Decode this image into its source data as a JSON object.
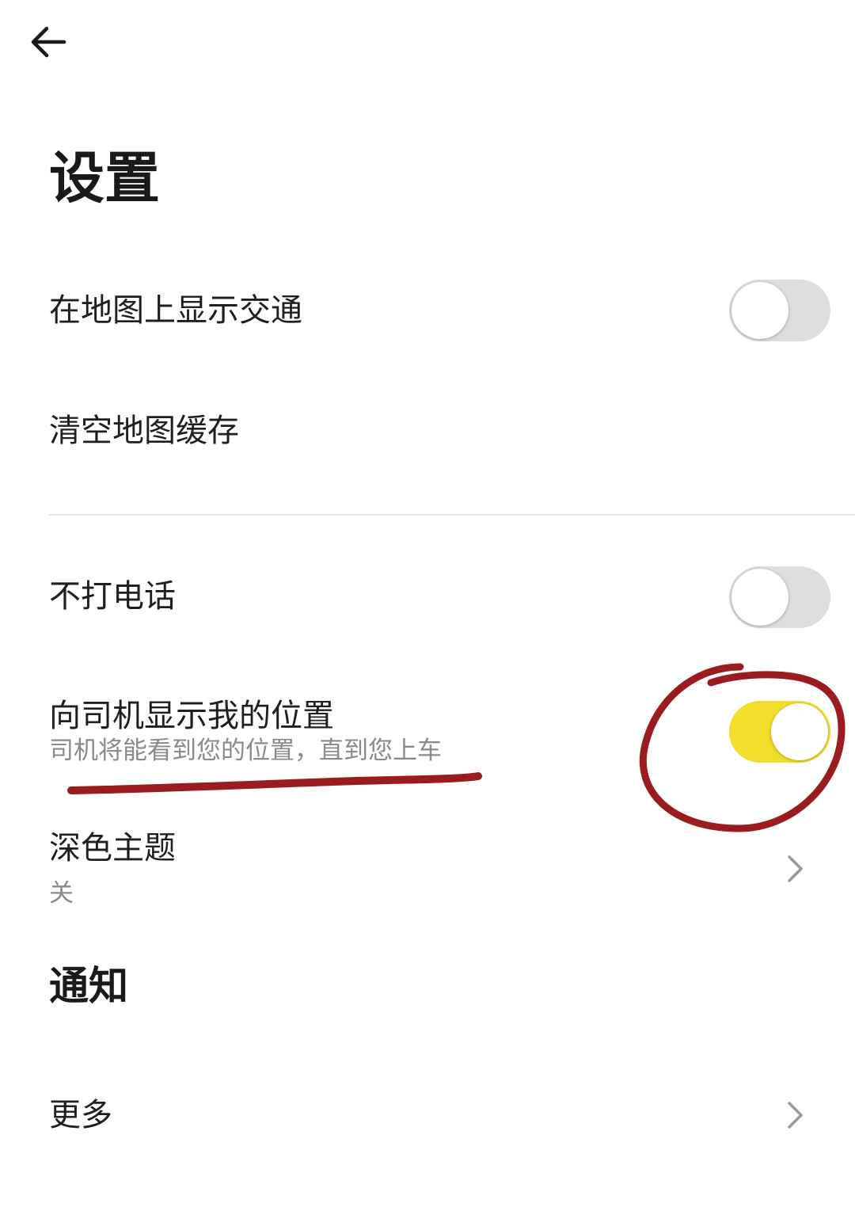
{
  "header": {
    "back_icon": "arrow-left-icon",
    "title": "设置"
  },
  "settings": {
    "show_traffic": {
      "label": "在地图上显示交通",
      "enabled": false
    },
    "clear_cache": {
      "label": "清空地图缓存"
    },
    "no_calls": {
      "label": "不打电话",
      "enabled": false
    },
    "show_location": {
      "label": "向司机显示我的位置",
      "description": "司机将能看到您的位置，直到您上车",
      "enabled": true
    },
    "dark_theme": {
      "label": "深色主题",
      "value": "关",
      "icon": "chevron-right-icon"
    }
  },
  "notifications": {
    "title": "通知",
    "more": {
      "label": "更多",
      "icon": "chevron-right-icon"
    }
  },
  "colors": {
    "toggle_on": "#f2dd2a",
    "toggle_off": "#dedede",
    "annotation": "#9b1c1f"
  }
}
